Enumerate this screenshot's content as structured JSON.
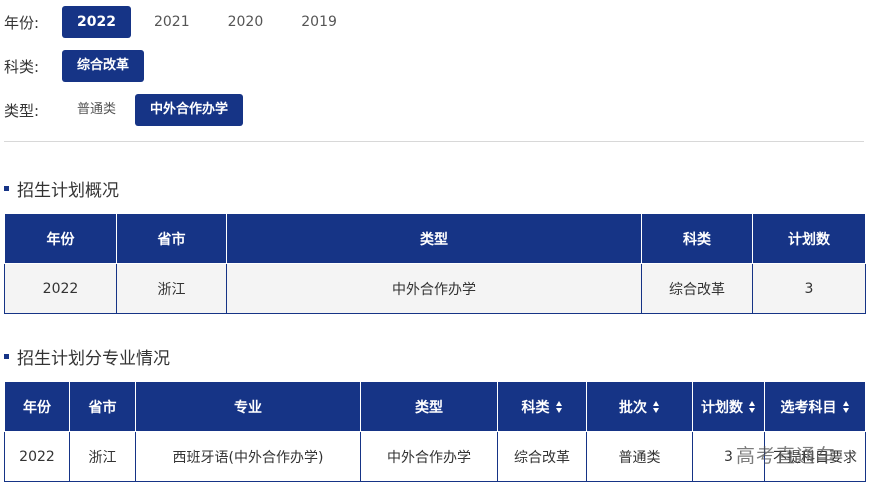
{
  "filters": {
    "year": {
      "label": "年份:",
      "options": [
        "2022",
        "2021",
        "2020",
        "2019"
      ],
      "selected": "2022"
    },
    "subject": {
      "label": "科类:",
      "options": [
        "综合改革"
      ],
      "selected": "综合改革"
    },
    "type": {
      "label": "类型:",
      "options": [
        "普通类",
        "中外合作办学"
      ],
      "selected": "中外合作办学"
    }
  },
  "overview": {
    "title": "招生计划概况",
    "headers": [
      "年份",
      "省市",
      "类型",
      "科类",
      "计划数"
    ],
    "rows": [
      [
        "2022",
        "浙江",
        "中外合作办学",
        "综合改革",
        "3"
      ]
    ]
  },
  "majors": {
    "title": "招生计划分专业情况",
    "headers": [
      "年份",
      "省市",
      "专业",
      "类型",
      "科类",
      "批次",
      "计划数",
      "选考科目"
    ],
    "rows": [
      [
        "2022",
        "浙江",
        "西班牙语(中外合作办学)",
        "中外合作办学",
        "综合改革",
        "普通类",
        "3",
        "不提科目要求"
      ]
    ]
  },
  "watermark": "高考直通车",
  "colors": {
    "accent": "#163486",
    "row_bg": "#f4f4f4"
  }
}
